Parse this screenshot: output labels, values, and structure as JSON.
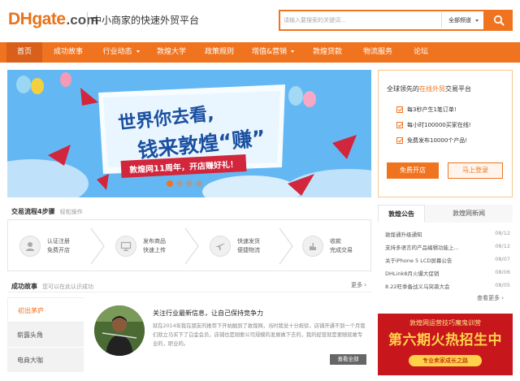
{
  "header": {
    "logo": {
      "dh": "DH",
      "gate": "gate",
      "com": ".com"
    },
    "tagline": "中小商家的快速外贸平台",
    "search": {
      "placeholder": "请输入要搜索的关键词...",
      "scope_label": "全部频道"
    }
  },
  "nav": {
    "items": [
      {
        "label": "首页",
        "dropdown": false
      },
      {
        "label": "成功故事",
        "dropdown": false
      },
      {
        "label": "行业动态",
        "dropdown": true
      },
      {
        "label": "敦煌大学",
        "dropdown": false
      },
      {
        "label": "政策规则",
        "dropdown": false
      },
      {
        "label": "增值&营销",
        "dropdown": true
      },
      {
        "label": "敦煌贷款",
        "dropdown": false
      },
      {
        "label": "物流服务",
        "dropdown": false
      },
      {
        "label": "论坛",
        "dropdown": false
      }
    ]
  },
  "banner": {
    "headline1": "世界你去看,",
    "headline2": "钱来敦煌“赚”",
    "ribbon": "敦煌网11周年，开店赚好礼！"
  },
  "promo": {
    "title_pre": "全球领先的",
    "title_hl": "在线外贸",
    "title_post": "交易平台",
    "items": [
      "每3秒产生1笔订单!",
      "每小时100000买家在线!",
      "免费发布10000个产品!"
    ],
    "btn_open": "免费开店",
    "btn_login": "马上登录"
  },
  "process": {
    "heading": "交易流程4步骤",
    "sub": "轻松操作",
    "steps": [
      {
        "line1": "认证注册",
        "line2": "免费开店"
      },
      {
        "line1": "发布商品",
        "line2": "快速上传"
      },
      {
        "line1": "快速发货",
        "line2": "便捷物流"
      },
      {
        "line1": "收款",
        "line2": "完成交易"
      }
    ]
  },
  "success": {
    "heading": "成功故事",
    "sub": "您可以在此认识成功",
    "more": "更多",
    "tabs": [
      "初出茅庐",
      "崭露头角",
      "电商大咖"
    ],
    "story": {
      "title": "关注行业最新信息，让自己保持竞争力",
      "body": "就在2014年我在朋友的推荐下开始触到了敦煌网，当时我觉十分担徐，店铺开通不到一个月我们就立马买下了白金会员，店铺也是刚要公司规模的发展做下去的，我的经营就是要随就敢专业的，职业的。",
      "button": "查看全部"
    }
  },
  "notices": {
    "tab_active": "敦煌公告",
    "tab_other": "敦煌网新闻",
    "items": [
      {
        "text": "敦煌通升级通知",
        "date": "08/12"
      },
      {
        "text": "支持多语言的产品编辑功能上...",
        "date": "08/12"
      },
      {
        "text": "关于iPhone 5 LCD屏幕公告",
        "date": "08/07"
      },
      {
        "text": "DHLink8月火爆大促销",
        "date": "08/06"
      },
      {
        "text": "8.22旺季备战义乌突袭大会",
        "date": "08/05"
      }
    ],
    "more": "查看更多"
  },
  "ad": {
    "top": "敦煌网运营技巧魔鬼训营",
    "main": "第六期火热招生中",
    "bottom": "专业卖家成长之路"
  },
  "colors": {
    "brand_orange": "#f0741f",
    "ad_red": "#c8161d",
    "banner_blue": "#63b8f4"
  }
}
